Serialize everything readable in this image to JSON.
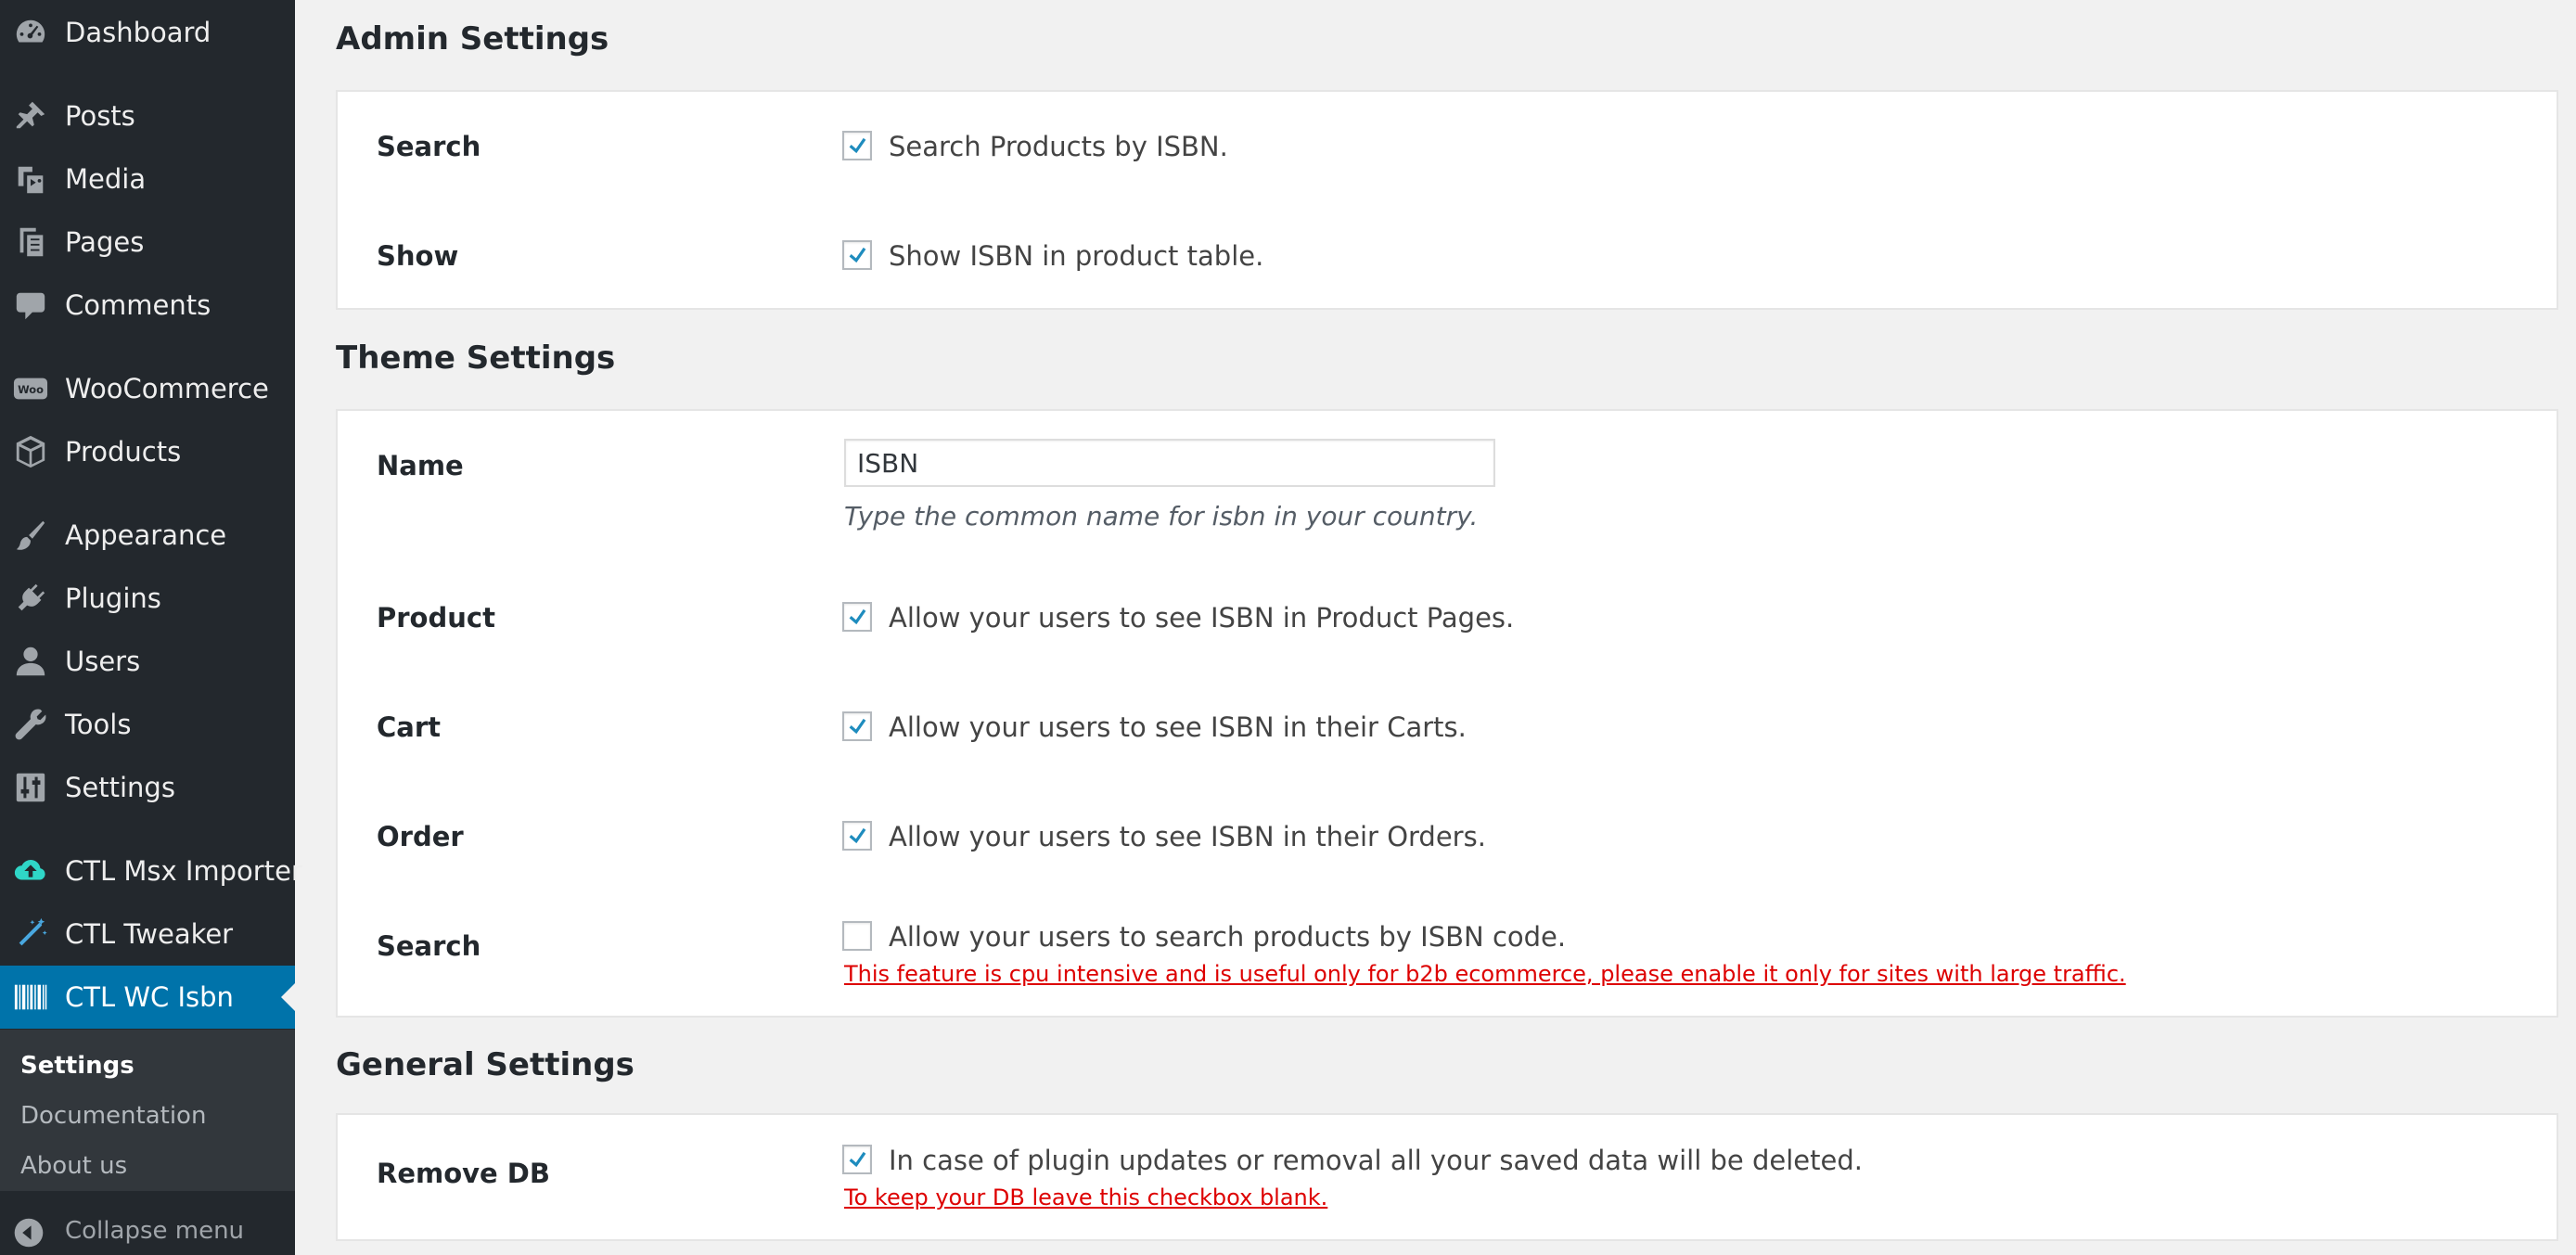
{
  "sidebar": {
    "items": [
      {
        "label": "Dashboard",
        "icon": "dashboard-icon"
      },
      {
        "label": "Posts",
        "icon": "pushpin-icon"
      },
      {
        "label": "Media",
        "icon": "media-icon"
      },
      {
        "label": "Pages",
        "icon": "pages-icon"
      },
      {
        "label": "Comments",
        "icon": "comment-bubble-icon"
      },
      {
        "label": "WooCommerce",
        "icon": "woocommerce-icon"
      },
      {
        "label": "Products",
        "icon": "box-icon"
      },
      {
        "label": "Appearance",
        "icon": "paintbrush-icon"
      },
      {
        "label": "Plugins",
        "icon": "plug-icon"
      },
      {
        "label": "Users",
        "icon": "user-icon"
      },
      {
        "label": "Tools",
        "icon": "wrench-icon"
      },
      {
        "label": "Settings",
        "icon": "sliders-icon"
      },
      {
        "label": "CTL Msx Importer",
        "icon": "cloud-upload-icon"
      },
      {
        "label": "CTL Tweaker",
        "icon": "magic-wand-icon"
      },
      {
        "label": "CTL WC Isbn",
        "icon": "barcode-icon"
      }
    ],
    "woo_badge": "Woo",
    "submenu": [
      {
        "label": "Settings"
      },
      {
        "label": "Documentation"
      },
      {
        "label": "About us"
      }
    ],
    "collapse_label": "Collapse menu"
  },
  "colors": {
    "sidebar_bg": "#23282d",
    "submenu_bg": "#32373c",
    "active_bg": "#0073aa",
    "checkbox_blue": "#1e8cbe",
    "warning_red": "#dd0000",
    "cloud_teal": "#2fd6c7",
    "wand_blue": "#49a8e0"
  },
  "admin_settings": {
    "title": "Admin Settings",
    "rows": [
      {
        "label": "Search",
        "checked": true,
        "text": "Search Products by ISBN."
      },
      {
        "label": "Show",
        "checked": true,
        "text": "Show ISBN in product table."
      }
    ]
  },
  "theme_settings": {
    "title": "Theme Settings",
    "name": {
      "label": "Name",
      "value": "ISBN",
      "help": "Type the common name for isbn in your country."
    },
    "rows": [
      {
        "label": "Product",
        "checked": true,
        "text": "Allow your users to see ISBN in Product Pages."
      },
      {
        "label": "Cart",
        "checked": true,
        "text": "Allow your users to see ISBN in their Carts."
      },
      {
        "label": "Order",
        "checked": true,
        "text": "Allow your users to see ISBN in their Orders."
      },
      {
        "label": "Search",
        "checked": false,
        "text": "Allow your users to search products by ISBN code.",
        "warning": "This feature is cpu intensive and is useful only for b2b ecommerce, please enable it only for sites with large traffic."
      }
    ]
  },
  "general_settings": {
    "title": "General Settings",
    "rows": [
      {
        "label": "Remove DB",
        "checked": true,
        "text": "In case of plugin updates or removal all your saved data will be deleted.",
        "warning": "To keep your DB leave this checkbox blank."
      }
    ]
  }
}
